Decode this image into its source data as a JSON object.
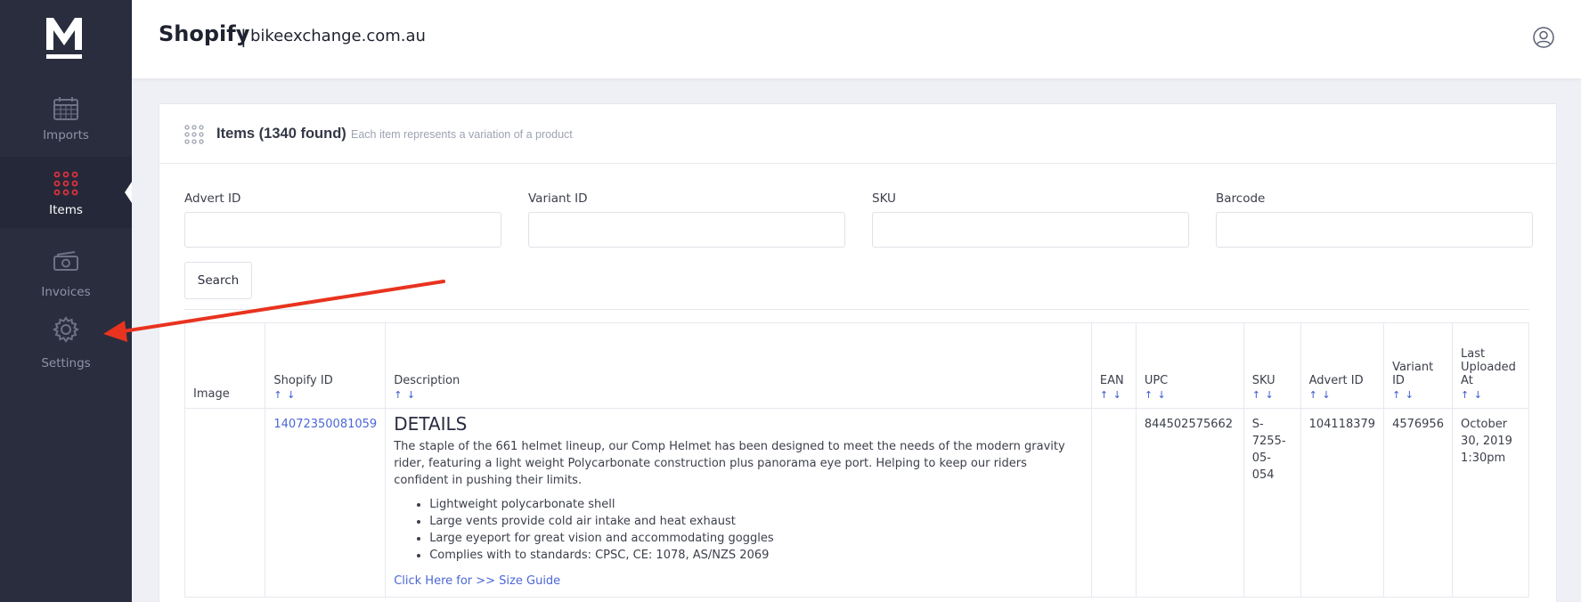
{
  "app": {
    "logo_letter": "M",
    "title": "Shopify",
    "separator": "|",
    "domain": "bikeexchange.com.au",
    "accent": "#e0323f",
    "sidebar_bg": "#2a2d3e",
    "link_color": "#4b67d6"
  },
  "sidebar": {
    "items": [
      {
        "label": "Imports",
        "icon": "calendar-icon",
        "active": false
      },
      {
        "label": "Items",
        "icon": "grid-dots-icon",
        "active": true
      },
      {
        "label": "Invoices",
        "icon": "money-icon",
        "active": false
      },
      {
        "label": "Settings",
        "icon": "gear-icon",
        "active": false
      }
    ]
  },
  "card": {
    "title": "Items (1340 found)",
    "subtitle": "Each item represents a variation of a product",
    "filters": [
      {
        "label": "Advert ID",
        "value": ""
      },
      {
        "label": "Variant ID",
        "value": ""
      },
      {
        "label": "SKU",
        "value": ""
      },
      {
        "label": "Barcode",
        "value": ""
      }
    ],
    "search_label": "Search"
  },
  "table": {
    "sort_glyph": "↑ ↓",
    "headers": [
      "Image",
      "Shopify ID",
      "Description",
      "EAN",
      "UPC",
      "SKU",
      "Advert ID",
      "Variant ID",
      "Last Uploaded At"
    ],
    "rows": [
      {
        "image": "",
        "shopify_id": "14072350081059",
        "desc_heading": "DETAILS",
        "desc_text": "The staple of the 661 helmet lineup, our Comp Helmet has been designed to meet the needs of the modern gravity rider, featuring a light weight Polycarbonate construction plus panorama eye port. Helping to keep our riders confident in pushing their limits.",
        "desc_bullets": [
          "Lightweight polycarbonate shell",
          "Large vents provide cold air intake and heat exhaust",
          "Large eyeport for great vision and accommodating goggles",
          "Complies with to standards: CPSC, CE: 1078, AS/NZS 2069"
        ],
        "desc_link": "Click Here for >> Size Guide",
        "ean": "",
        "upc": "844502575662",
        "sku": "S-7255-05-054",
        "advert_id": "104118379",
        "variant_id": "4576956",
        "last_uploaded": "October 30, 2019 1:30pm"
      }
    ]
  },
  "annotation": {
    "arrow_color": "#e8331f"
  }
}
